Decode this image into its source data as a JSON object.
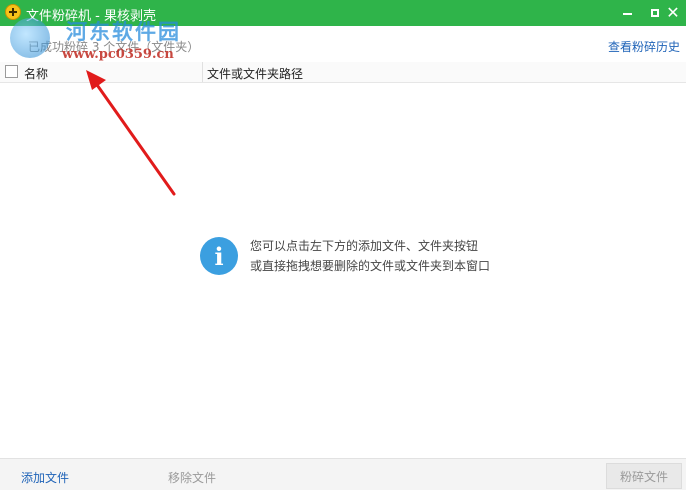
{
  "window": {
    "title": "文件粉碎机 - 果核剥壳",
    "close_glyph": "✕",
    "accent_color": "#2fb44a"
  },
  "watermark": {
    "site_name": "河东软件园",
    "url": "www.pc0359.cn"
  },
  "toolbar": {
    "status": "已成功粉碎 3 个文件（文件夹）",
    "history_link": "查看粉碎历史"
  },
  "table": {
    "columns": [
      "名称",
      "文件或文件夹路径"
    ],
    "rows": []
  },
  "empty_hint": {
    "icon": "info-icon",
    "line1": "您可以点击左下方的添加文件、文件夹按钮",
    "line2": "或直接拖拽想要删除的文件或文件夹到本窗口"
  },
  "footer": {
    "add_label": "添加文件",
    "remove_label": "移除文件",
    "shred_label": "粉碎文件"
  }
}
